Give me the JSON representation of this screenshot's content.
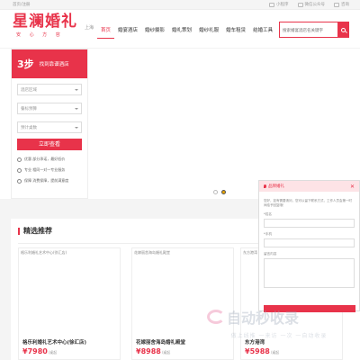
{
  "topbar": {
    "left": "首页/注册",
    "links": [
      "小程序",
      "微信公众号",
      "咨询"
    ]
  },
  "header": {
    "logo": "星澜婚礼",
    "logo_sub": "安 心 方 容",
    "city": "上海",
    "nav": [
      "首页",
      "婚宴酒店",
      "婚纱摄影",
      "婚礼策划",
      "婚纱礼服",
      "婚车租赁",
      "结婚工具"
    ],
    "search_placeholder": "搜索婚宴酒店名关键字"
  },
  "panel": {
    "step": "3步",
    "hint": "找到靠谱酒店",
    "selects": [
      "酒店区域",
      "餐标预算",
      "预计桌数"
    ],
    "button": "立即查看",
    "features": [
      "优惠  部分承诺，最好低价",
      "专业  相同一对一专业服务",
      "保障  消费保障，提前满意度"
    ]
  },
  "picks": {
    "title": "精选推荐",
    "cards": [
      {
        "alt": "格乐利婚礼艺术中心(徐汇店)",
        "name": "格乐利婚礼艺术中心(徐汇店)",
        "price": "¥7980",
        "unit": "/桌起"
      },
      {
        "alt": "花嫁丽舍海岛婚礼殿堂",
        "name": "花嫁丽舍海岛婚礼殿堂",
        "price": "¥8988",
        "unit": "/桌起"
      },
      {
        "alt": "东方港湾",
        "name": "东方港湾",
        "price": "¥5988",
        "unit": "/桌起"
      }
    ]
  },
  "popup": {
    "title": "品牌婚礼",
    "intro": "您好，如有需要请问，您可以留下联系方式，工作人员会第一时间给予回复哦！",
    "labels": [
      "*姓名",
      "*手机",
      "留言内容"
    ]
  },
  "watermark": {
    "big": "自动秒收录",
    "small": "做上线推 一来访 一次 一自动收录"
  }
}
